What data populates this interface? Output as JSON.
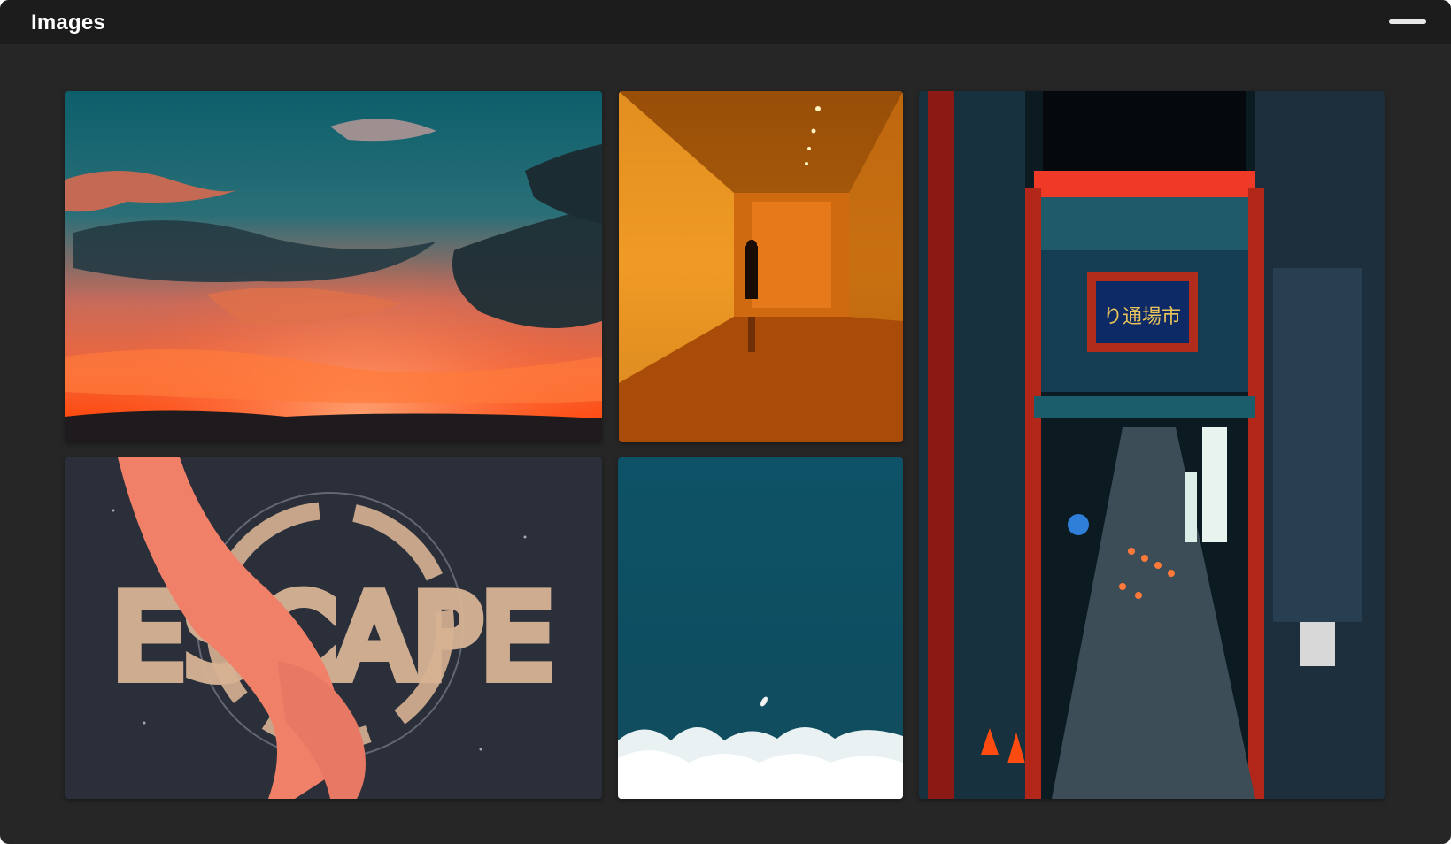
{
  "window": {
    "title": "Images",
    "minimize_icon": "minimize-icon"
  },
  "colors": {
    "window_bg": "#262626",
    "titlebar_bg": "#1c1c1c",
    "title_text": "#ffffff"
  },
  "gallery": {
    "images": [
      {
        "id": "sunset",
        "icon": "image-sunset-sky"
      },
      {
        "id": "hallway",
        "icon": "image-orange-hallway"
      },
      {
        "id": "escape",
        "icon": "image-escape-illustration",
        "artwork_text": "ESCAPE"
      },
      {
        "id": "ocean",
        "icon": "image-aerial-ocean"
      },
      {
        "id": "street",
        "icon": "image-night-street",
        "artwork_text": "り通場市"
      }
    ]
  }
}
